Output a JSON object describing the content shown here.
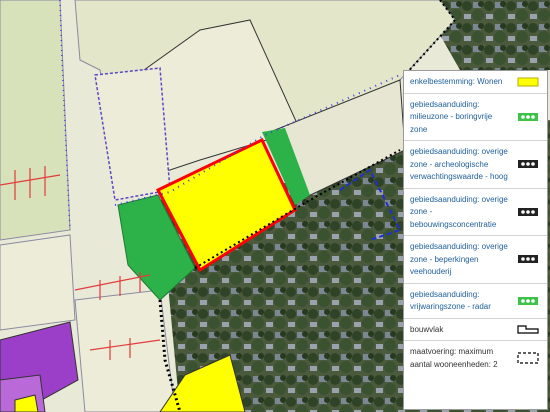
{
  "map": {
    "colors": {
      "background": "#e9e9d8",
      "agricultural": "#d8e2ba",
      "residential": "#ffff00",
      "residential_border": "#ff0000",
      "green": "#2db24a",
      "purple": "#9b3fc8",
      "boundary_blue": "#4040e0",
      "boundary_black": "#000000",
      "measure_red": "#e33b3b"
    },
    "layers": [
      "enkelbestemming: Wonen",
      "gebiedsaanduiding",
      "bouwvlak",
      "maatvoering"
    ]
  },
  "legend": {
    "items": [
      {
        "label": "enkelbestemming: Wonen",
        "icon": "yellow-fill-swatch",
        "color": "#ffff00"
      },
      {
        "label": "gebiedsaanduiding: milieuzone - boringvrije zone",
        "icon": "green-hatch-swatch",
        "color": "#3cc24a"
      },
      {
        "label": "gebiedsaanduiding: overige zone - archeologische verwachtingswaarde - hoog",
        "icon": "black-hatch-swatch",
        "color": "#000000"
      },
      {
        "label": "gebiedsaanduiding: overige zone - bebouwingsconcentratie",
        "icon": "black-hatch-swatch",
        "color": "#000000"
      },
      {
        "label": "gebiedsaanduiding: overige zone - beperkingen veehouderij",
        "icon": "black-hatch-swatch",
        "color": "#000000"
      },
      {
        "label": "gebiedsaanduiding: vrijwaringszone - radar",
        "icon": "green-hatch-swatch",
        "color": "#3cc24a"
      },
      {
        "label": "bouwvlak",
        "icon": "building-outline-swatch",
        "color": "#000000"
      },
      {
        "label": "maatvoering: maximum aantal wooneenheden: 2",
        "icon": "dashed-box-swatch",
        "color": "#000000"
      }
    ]
  }
}
